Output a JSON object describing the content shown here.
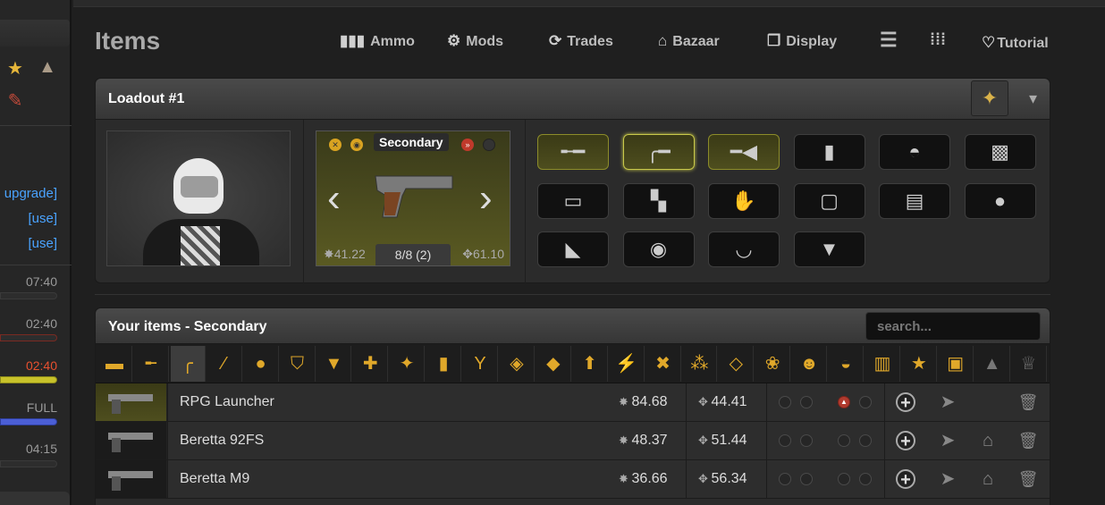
{
  "page": {
    "title": "Items"
  },
  "nav": [
    {
      "label": "Ammo",
      "icon": "ammo-icon",
      "glyph": "▮▮▮"
    },
    {
      "label": "Mods",
      "icon": "mods-icon",
      "glyph": "⚙"
    },
    {
      "label": "Trades",
      "icon": "trades-icon",
      "glyph": "⟳"
    },
    {
      "label": "Bazaar",
      "icon": "bazaar-icon",
      "glyph": "⌂"
    },
    {
      "label": "Display",
      "icon": "display-icon",
      "glyph": "❐"
    },
    {
      "label": "",
      "icon": "list-view-icon",
      "glyph": "☰"
    },
    {
      "label": "",
      "icon": "grid-view-icon",
      "glyph": "⁞⁞⁞"
    },
    {
      "label": "Tutorial",
      "icon": "lightbulb-icon",
      "glyph": "♡"
    }
  ],
  "sidebar": {
    "links": [
      "upgrade]",
      "[use]",
      "[use]"
    ],
    "times": [
      "07:40",
      "02:40",
      "02:40",
      "FULL",
      "04:15"
    ],
    "time_colors": [
      "#9a9a9a",
      "#9a9a9a",
      "#e8502f",
      "#9a9a9a",
      "#9a9a9a"
    ],
    "bars": [
      {
        "color": "#2d2d2d",
        "fill": 0.0
      },
      {
        "color": "#c0392b",
        "fill": 0.0
      },
      {
        "color": "#c8c22a",
        "fill": 0.45
      },
      {
        "color": "#4b5fd6",
        "fill": 1.0
      },
      {
        "color": "#3a3a3a",
        "fill": 0.0
      }
    ]
  },
  "loadout": {
    "title": "Loadout #1",
    "weapon": {
      "label": "Secondary",
      "damage": "41.22",
      "ammo": "8/8 (2)",
      "accuracy": "61.10"
    },
    "slots": [
      {
        "name": "slot-rifle",
        "glyph": "╾━",
        "equipped": true,
        "active": false
      },
      {
        "name": "slot-pistol",
        "glyph": "╭━",
        "equipped": true,
        "active": true
      },
      {
        "name": "slot-melee",
        "glyph": "━◀",
        "equipped": true,
        "active": false
      },
      {
        "name": "slot-grenade",
        "glyph": "▮",
        "equipped": false,
        "active": false
      },
      {
        "name": "slot-helmet",
        "glyph": "◓",
        "equipped": false,
        "active": false
      },
      {
        "name": "slot-body-armor",
        "glyph": "▩",
        "equipped": false,
        "active": false
      },
      {
        "name": "slot-pants",
        "glyph": "▭",
        "equipped": false,
        "active": false
      },
      {
        "name": "slot-boots",
        "glyph": "▚",
        "equipped": false,
        "active": false
      },
      {
        "name": "slot-gloves",
        "glyph": "✋",
        "equipped": false,
        "active": false
      },
      {
        "name": "slot-top",
        "glyph": "▢",
        "equipped": false,
        "active": false
      },
      {
        "name": "slot-coat",
        "glyph": "▤",
        "equipped": false,
        "active": false
      },
      {
        "name": "slot-mask",
        "glyph": "●",
        "equipped": false,
        "active": false
      },
      {
        "name": "slot-socks",
        "glyph": "◣",
        "equipped": false,
        "active": false
      },
      {
        "name": "slot-face-mask",
        "glyph": "◉",
        "equipped": false,
        "active": false
      },
      {
        "name": "slot-necklace",
        "glyph": "◡",
        "equipped": false,
        "active": false
      },
      {
        "name": "slot-shirt",
        "glyph": "▼",
        "equipped": false,
        "active": false
      }
    ]
  },
  "items": {
    "title": "Your items - Secondary",
    "search_placeholder": "search...",
    "filters": [
      {
        "name": "filter-all-icon",
        "glyph": "▬"
      },
      {
        "name": "filter-primary-icon",
        "glyph": "╾"
      },
      {
        "name": "filter-secondary-icon",
        "glyph": "╭"
      },
      {
        "name": "filter-melee-icon",
        "glyph": "⁄"
      },
      {
        "name": "filter-temporary-icon",
        "glyph": "●"
      },
      {
        "name": "filter-defensive-icon",
        "glyph": "⛉"
      },
      {
        "name": "filter-clothing-icon",
        "glyph": "▼"
      },
      {
        "name": "filter-medical-icon",
        "glyph": "✚"
      },
      {
        "name": "filter-drugs-icon",
        "glyph": "✦"
      },
      {
        "name": "filter-energy-drink-icon",
        "glyph": "▮"
      },
      {
        "name": "filter-alcohol-icon",
        "glyph": "Y"
      },
      {
        "name": "filter-candy-icon",
        "glyph": "◈"
      },
      {
        "name": "filter-boosters-icon",
        "glyph": "◆"
      },
      {
        "name": "filter-enhancers-icon",
        "glyph": "⬆"
      },
      {
        "name": "filter-special-icon",
        "glyph": "⚡"
      },
      {
        "name": "filter-tools-icon",
        "glyph": "✖"
      },
      {
        "name": "filter-supply-pack-icon",
        "glyph": "⁂"
      },
      {
        "name": "filter-jewelry-icon",
        "glyph": "◇"
      },
      {
        "name": "filter-flowers-icon",
        "glyph": "❀"
      },
      {
        "name": "filter-plushies-icon",
        "glyph": "☻"
      },
      {
        "name": "filter-cars-icon",
        "glyph": "◒"
      },
      {
        "name": "filter-collectibles-icon",
        "glyph": "▥"
      },
      {
        "name": "filter-artifacts-icon",
        "glyph": "★"
      },
      {
        "name": "filter-miscellaneous-icon",
        "glyph": "▣"
      },
      {
        "name": "filter-trash-icon",
        "glyph": "▲"
      },
      {
        "name": "filter-trophies-icon",
        "glyph": "♕"
      }
    ],
    "rows": [
      {
        "name": "RPG Launcher",
        "damage": "84.68",
        "accuracy": "44.41",
        "equipped": true,
        "has_unequip": true
      },
      {
        "name": "Beretta 92FS",
        "damage": "48.37",
        "accuracy": "51.44",
        "equipped": false,
        "has_unequip": false
      },
      {
        "name": "Beretta M9",
        "damage": "36.66",
        "accuracy": "56.34",
        "equipped": false,
        "has_unequip": false
      }
    ]
  }
}
